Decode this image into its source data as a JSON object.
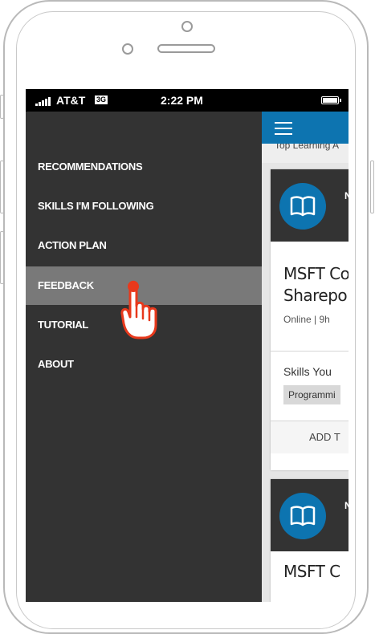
{
  "status_bar": {
    "carrier": "AT&T",
    "network": "3G",
    "time": "2:22 PM"
  },
  "drawer": {
    "items": [
      {
        "label": "RECOMMENDATIONS",
        "active": false
      },
      {
        "label": "SKILLS I'M FOLLOWING",
        "active": false
      },
      {
        "label": "ACTION PLAN",
        "active": false
      },
      {
        "label": "FEEDBACK",
        "active": true
      },
      {
        "label": "TUTORIAL",
        "active": false
      },
      {
        "label": "ABOUT",
        "active": false
      }
    ]
  },
  "main": {
    "subheader": "Top Learning A",
    "card": {
      "head_text": "N",
      "title_line1": "MSFT Co",
      "title_line2": "Sharepo",
      "meta": "Online | 9h",
      "skills_label": "Skills You",
      "chip": "Programmi",
      "add_label": "ADD T"
    },
    "card2": {
      "head_text": "N",
      "title_line1": "MSFT C"
    }
  },
  "colors": {
    "drawer_bg": "#333333",
    "active_item_bg": "#797979",
    "accent_blue": "#0d74b0",
    "tap_red": "#e8391c"
  },
  "icons": [
    "signal-icon",
    "battery-icon",
    "hamburger-icon",
    "book-icon",
    "tap-gesture-icon"
  ]
}
